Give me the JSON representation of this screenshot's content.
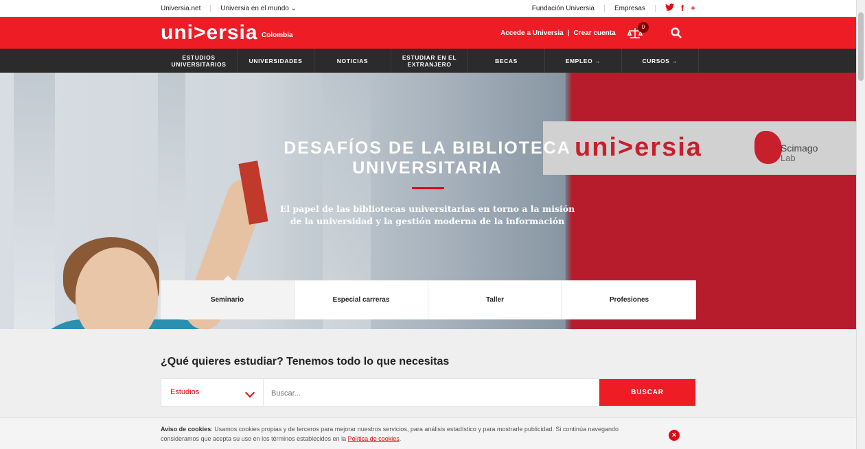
{
  "topbar": {
    "left": [
      "Universia.net",
      "Universia en el mundo ⌄"
    ],
    "right": [
      "Fundación Universia",
      "Empresas"
    ],
    "social": [
      "twitter-icon",
      "facebook-icon",
      "plus-icon"
    ]
  },
  "header": {
    "logo": "uni>ersia",
    "country": "Colombia",
    "login": "Accede a Universia",
    "separator": "|",
    "register": "Crear cuenta",
    "compare_count": "0"
  },
  "nav": [
    "ESTUDIOS UNIVERSITARIOS",
    "UNIVERSIDADES",
    "NOTICIAS",
    "ESTUDIAR EN EL EXTRANJERO",
    "BECAS",
    "EMPLEO →",
    "CURSOS →"
  ],
  "hero": {
    "title": "DESAFÍOS DE LA BIBLIOTECA UNIVERSITARIA",
    "subtitle": "El papel de las bibliotecas universitarias en torno a la misión de la universidad y la gestión moderna de la información",
    "partner_logo_1": "uni>ersia",
    "partner_logo_2a": "Scimago",
    "partner_logo_2b": "Lab"
  },
  "tabs": [
    "Seminario",
    "Especial carreras",
    "Taller",
    "Profesiones"
  ],
  "search": {
    "question": "¿Qué quieres estudiar? Tenemos todo lo que necesitas",
    "select_value": "Estudios",
    "placeholder": "Buscar...",
    "button": "BUSCAR"
  },
  "cookies": {
    "label": "Aviso de cookies",
    "text": ": Usamos cookies propias y de terceros para mejorar nuestros servicios, para análisis estadístico y para mostrarle publicidad. Si continúa navegando consideramos que acepta su uso en los términos establecidos en la ",
    "link": "Política de cookies",
    "end": "."
  },
  "colors": {
    "brand": "#ee1c25",
    "nav": "#2b2b2b",
    "hero_red": "#b71c2c"
  }
}
